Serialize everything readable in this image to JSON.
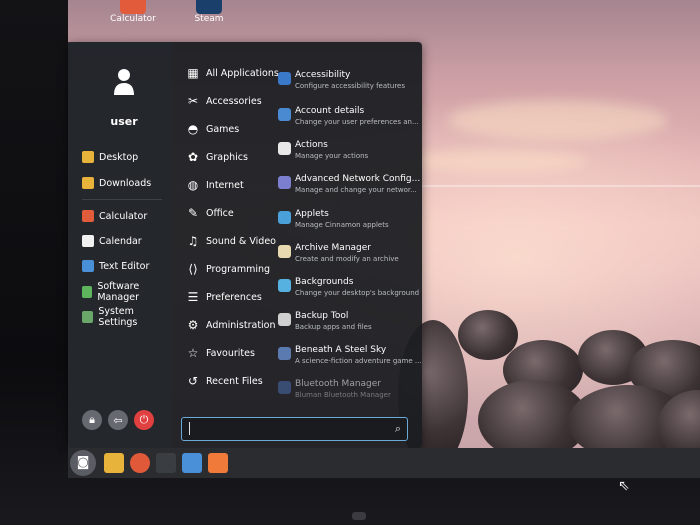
{
  "desktop": {
    "icons": [
      {
        "label": "Calculator",
        "icon": "calculator-icon"
      },
      {
        "label": "Steam",
        "icon": "steam-icon"
      }
    ]
  },
  "menu": {
    "user": "user",
    "places": [
      {
        "label": "Desktop",
        "icon": "folder-icon",
        "color": "#e8b33a"
      },
      {
        "label": "Downloads",
        "icon": "downloads-folder-icon",
        "color": "#e8b33a"
      }
    ],
    "favorites": [
      {
        "label": "Calculator",
        "icon": "calculator-icon",
        "color": "#e25b3a"
      },
      {
        "label": "Calendar",
        "icon": "calendar-icon",
        "color": "#f1f1f1"
      },
      {
        "label": "Text Editor",
        "icon": "text-editor-icon",
        "color": "#4a90d9"
      },
      {
        "label": "Software Manager",
        "icon": "software-manager-icon",
        "color": "#5eb55e"
      },
      {
        "label": "System Settings",
        "icon": "settings-icon",
        "color": "#6aa86a"
      }
    ],
    "session": [
      {
        "name": "lock-button",
        "icon": "lock-icon",
        "color": "#666a70"
      },
      {
        "name": "logout-button",
        "icon": "logout-icon",
        "color": "#666a70"
      },
      {
        "name": "shutdown-button",
        "icon": "power-icon",
        "color": "#e04040"
      }
    ],
    "categories": [
      {
        "label": "All Applications",
        "icon": "grid-icon"
      },
      {
        "label": "Accessories",
        "icon": "accessories-icon"
      },
      {
        "label": "Games",
        "icon": "gamepad-icon"
      },
      {
        "label": "Graphics",
        "icon": "graphics-icon"
      },
      {
        "label": "Internet",
        "icon": "globe-icon"
      },
      {
        "label": "Office",
        "icon": "office-icon"
      },
      {
        "label": "Sound & Video",
        "icon": "media-icon"
      },
      {
        "label": "Programming",
        "icon": "code-icon"
      },
      {
        "label": "Preferences",
        "icon": "preferences-icon"
      },
      {
        "label": "Administration",
        "icon": "gear-icon"
      },
      {
        "label": "Favourites",
        "icon": "star-icon"
      },
      {
        "label": "Recent Files",
        "icon": "history-icon"
      }
    ],
    "apps": [
      {
        "name": "Accessibility",
        "desc": "Configure accessibility features",
        "color": "#3a78c8"
      },
      {
        "name": "Account details",
        "desc": "Change your user preferences an...",
        "color": "#4a8ad0"
      },
      {
        "name": "Actions",
        "desc": "Manage your actions",
        "color": "#e8e8e8"
      },
      {
        "name": "Advanced Network Config...",
        "desc": "Manage and change your networ...",
        "color": "#7c7fcf"
      },
      {
        "name": "Applets",
        "desc": "Manage Cinnamon applets",
        "color": "#4aa0d8"
      },
      {
        "name": "Archive Manager",
        "desc": "Create and modify an archive",
        "color": "#e8d9b0"
      },
      {
        "name": "Backgrounds",
        "desc": "Change your desktop's background",
        "color": "#56b0e0"
      },
      {
        "name": "Backup Tool",
        "desc": "Backup apps and files",
        "color": "#d0d0d0"
      },
      {
        "name": "Beneath A Steel Sky",
        "desc": "A science-fiction adventure game ...",
        "color": "#5a7ab0"
      },
      {
        "name": "Bluetooth Manager",
        "desc": "Bluman Bluetooth Manager",
        "color": "#4a6fb0"
      }
    ],
    "search_placeholder": ""
  },
  "taskbar": {
    "items": [
      {
        "name": "menu-button",
        "icon": "mint-logo-icon",
        "color": "#5a5d63"
      },
      {
        "name": "files-launcher",
        "icon": "folder-icon",
        "color": "#e8b33a"
      },
      {
        "name": "software-launcher",
        "icon": "power-icon",
        "color": "#e05a3a"
      },
      {
        "name": "terminal-launcher",
        "icon": "terminal-icon",
        "color": "#3a3d42"
      },
      {
        "name": "text-editor-launcher",
        "icon": "text-editor-icon",
        "color": "#4a90d9"
      },
      {
        "name": "brave-launcher",
        "icon": "brave-icon",
        "color": "#f07a3a"
      }
    ]
  }
}
